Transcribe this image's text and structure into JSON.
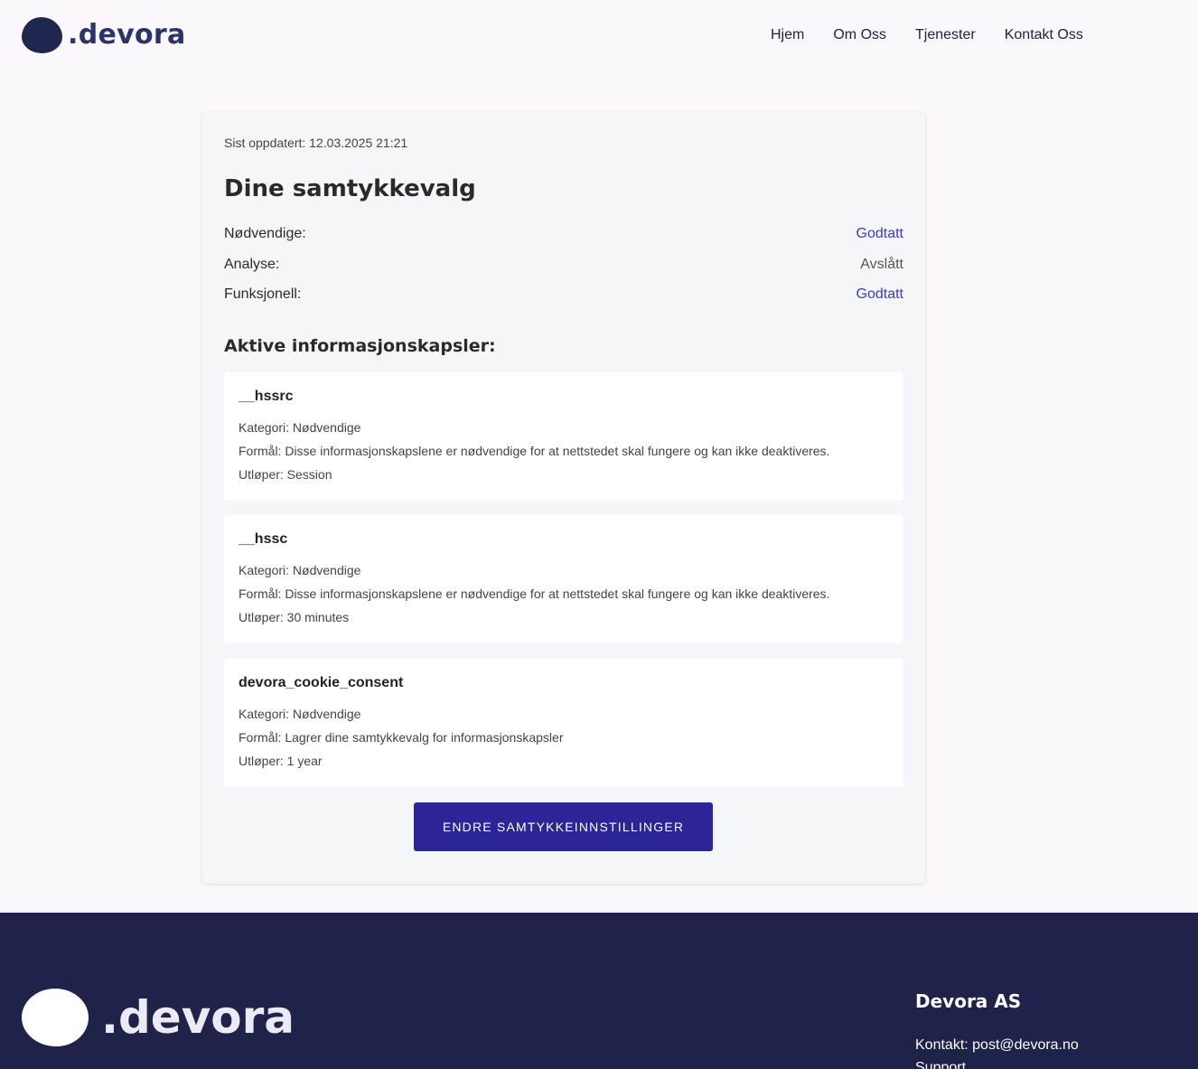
{
  "header": {
    "logo_text": ".devora",
    "nav": [
      "Hjem",
      "Om Oss",
      "Tjenester",
      "Kontakt Oss"
    ]
  },
  "card": {
    "updated": "Sist oppdatert: 12.03.2025 21:21",
    "title": "Dine samtykkevalg",
    "consents": [
      {
        "label": "Nødvendige:",
        "status": "Godtatt"
      },
      {
        "label": "Analyse:",
        "status": "Avslått"
      },
      {
        "label": "Funksjonell:",
        "status": "Godtatt"
      }
    ],
    "cookies_title": "Aktive informasjonskapsler:",
    "cookies": [
      {
        "name": "__hssrc",
        "category": "Kategori: Nødvendige",
        "purpose": "Formål: Disse informasjonskapslene er nødvendige for at nettstedet skal fungere og kan ikke deaktiveres.",
        "expires": "Utløper: Session"
      },
      {
        "name": "__hssc",
        "category": "Kategori: Nødvendige",
        "purpose": "Formål: Disse informasjonskapslene er nødvendige for at nettstedet skal fungere og kan ikke deaktiveres.",
        "expires": "Utløper: 30 minutes"
      },
      {
        "name": "devora_cookie_consent",
        "category": "Kategori: Nødvendige",
        "purpose": "Formål: Lagrer dine samtykkevalg for informasjonskapsler",
        "expires": "Utløper: 1 year"
      }
    ],
    "change_button": "ENDRE SAMTYKKEINNSTILLINGER"
  },
  "footer": {
    "logo_text": ".devora",
    "company": "Devora AS",
    "contact_label": "Kontakt:",
    "contact_email": "post@devora.no",
    "cut_line": "Support"
  },
  "colors": {
    "accent": "#2b2597",
    "accepted": "#3a3ad0",
    "footer_bg": "#1f2249",
    "page_bg": "#fcf7fc"
  }
}
